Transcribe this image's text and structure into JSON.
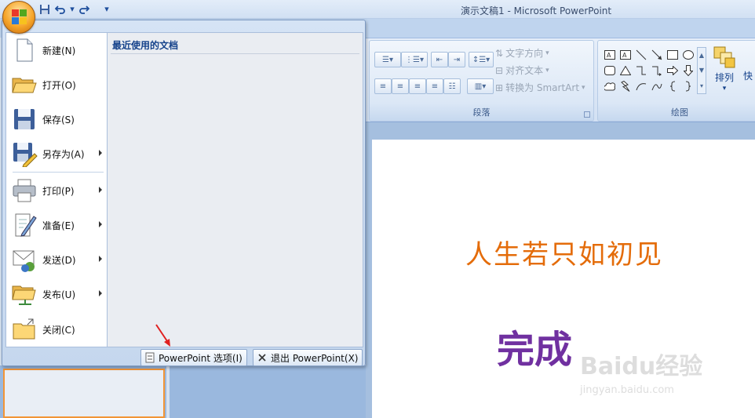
{
  "window": {
    "title": "演示文稿1 - Microsoft PowerPoint"
  },
  "quick_access": {
    "icons": [
      "save-icon",
      "undo-icon",
      "redo-icon",
      "customize-icon"
    ]
  },
  "office_menu": {
    "items": [
      {
        "label": "新建(N)",
        "icon": "new-document-icon",
        "submenu": false
      },
      {
        "label": "打开(O)",
        "icon": "open-folder-icon",
        "submenu": false
      },
      {
        "label": "保存(S)",
        "icon": "save-icon",
        "submenu": false
      },
      {
        "label": "另存为(A)",
        "icon": "save-as-icon",
        "submenu": true
      },
      {
        "label": "打印(P)",
        "icon": "print-icon",
        "submenu": true
      },
      {
        "label": "准备(E)",
        "icon": "prepare-icon",
        "submenu": true
      },
      {
        "label": "发送(D)",
        "icon": "send-icon",
        "submenu": true
      },
      {
        "label": "发布(U)",
        "icon": "publish-icon",
        "submenu": true
      },
      {
        "label": "关闭(C)",
        "icon": "close-folder-icon",
        "submenu": false
      }
    ],
    "recent_header": "最近使用的文档",
    "options_button": "PowerPoint 选项(I)",
    "exit_button": "退出 PowerPoint(X)"
  },
  "ribbon": {
    "paragraph": {
      "label": "段落",
      "text_direction": "文字方向",
      "align_text": "对齐文本",
      "convert_smartart": "转换为 SmartArt"
    },
    "drawing": {
      "label": "绘图",
      "arrange": "排列",
      "quick_styles_partial": "快"
    }
  },
  "slide": {
    "title": "人生若只如初见",
    "body": "完成"
  },
  "watermark": {
    "brand": "Baidu经验",
    "url": "jingyan.baidu.com"
  },
  "colors": {
    "slide_title": "#e46c0a",
    "slide_body": "#7030a0",
    "annotation_arrow": "#e02020"
  }
}
